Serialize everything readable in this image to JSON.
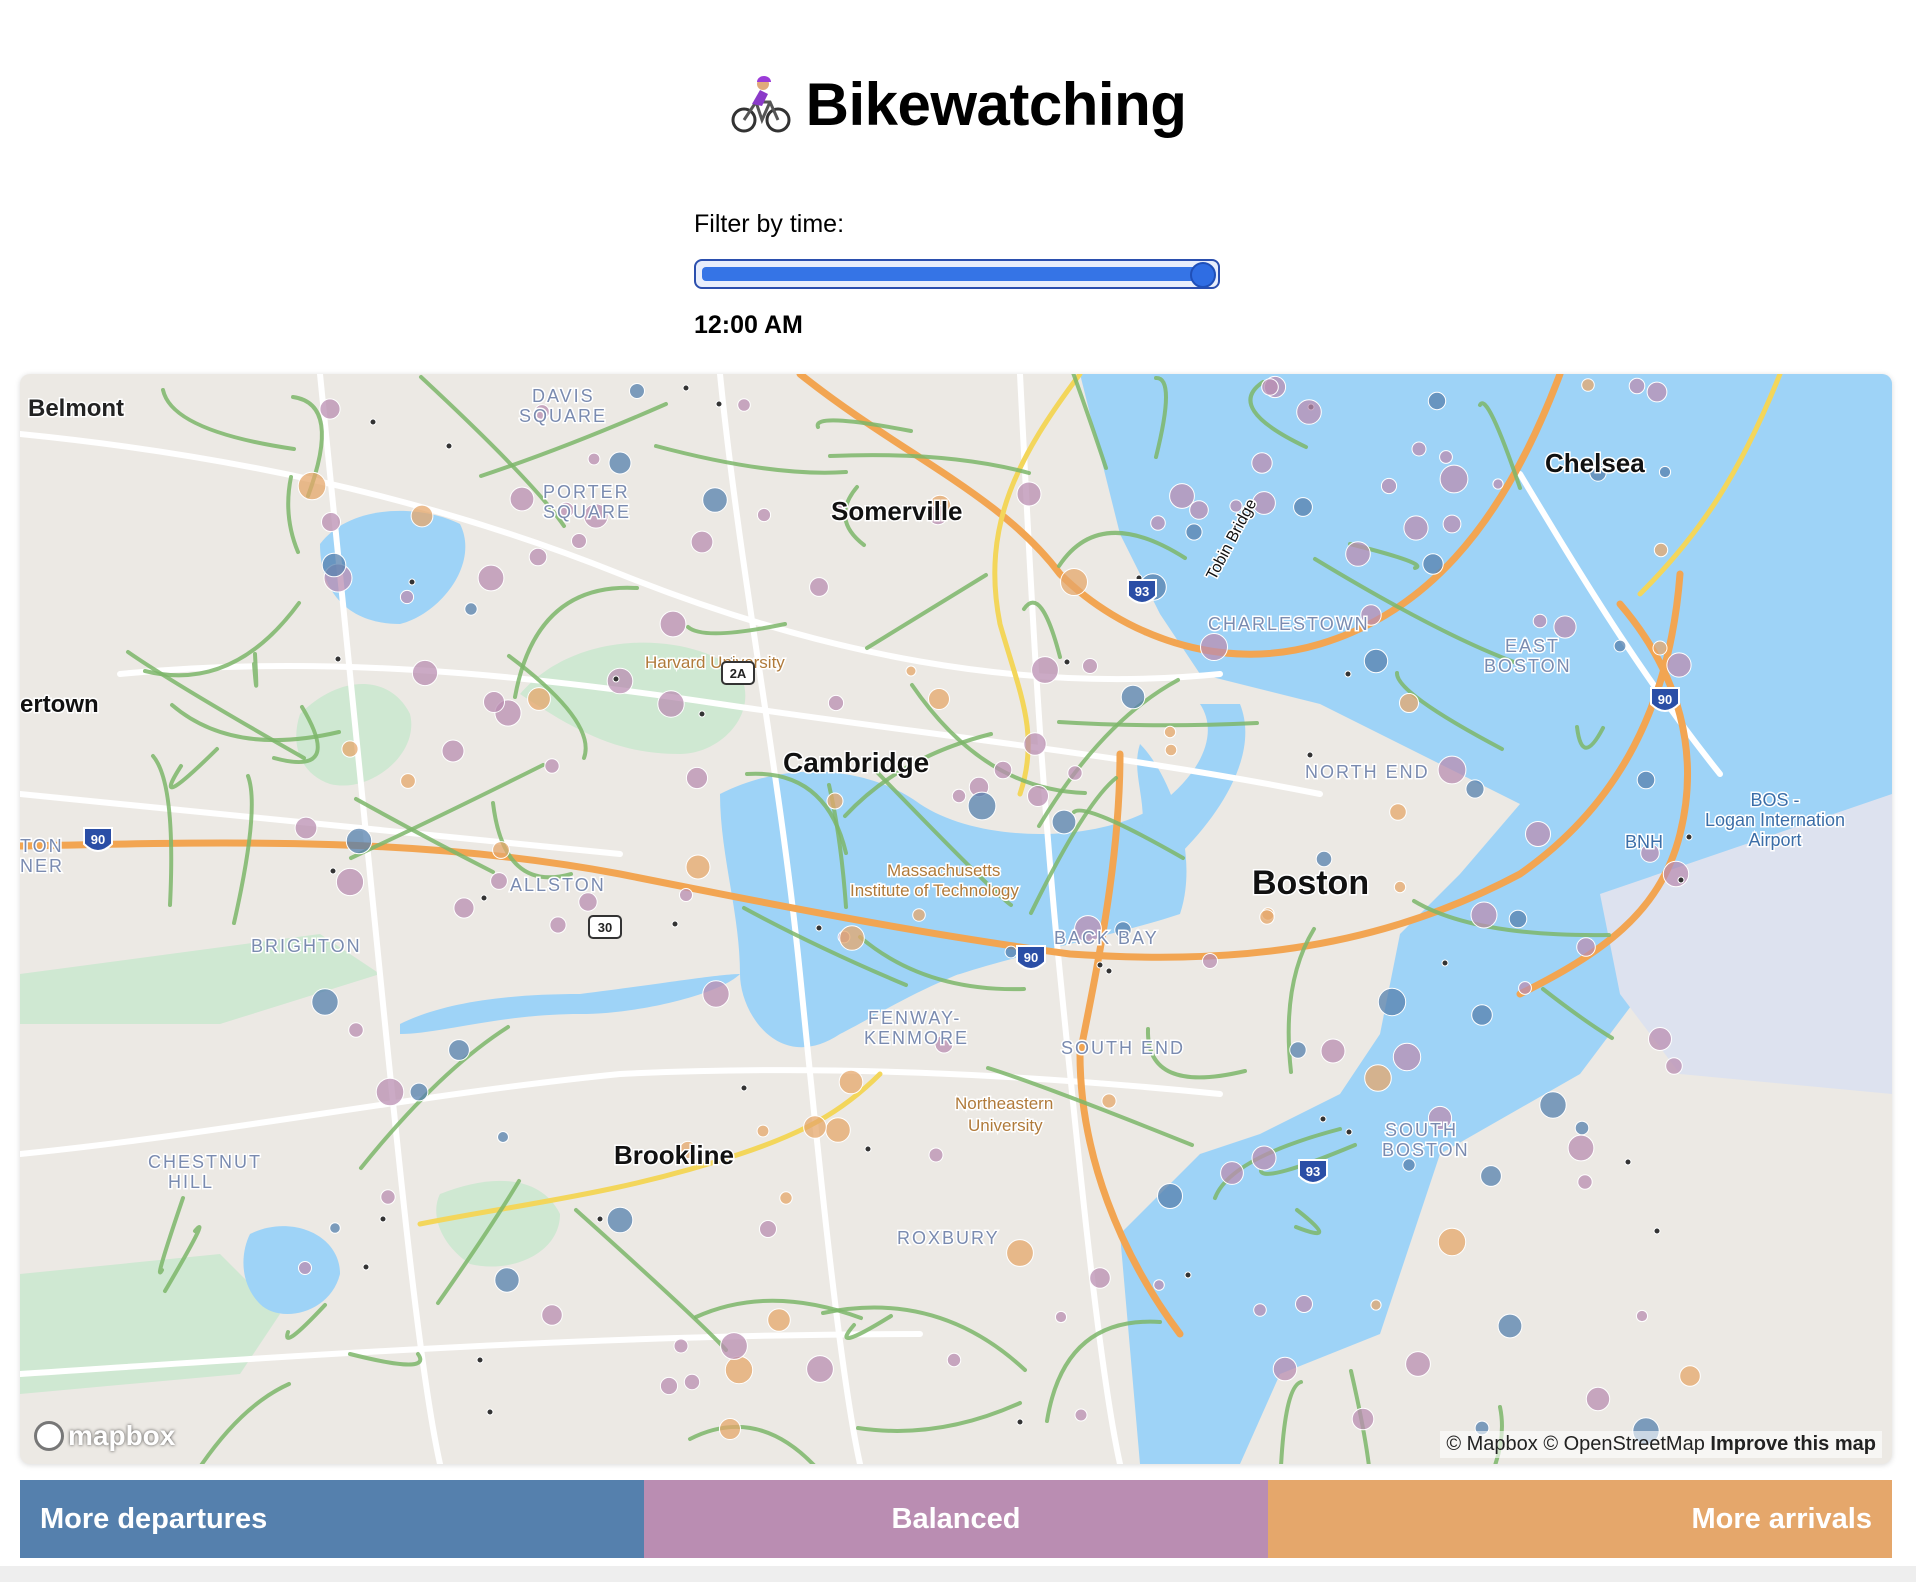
{
  "header": {
    "title": "Bikewatching",
    "icon": "person-biking-icon"
  },
  "filter": {
    "label": "Filter by time:",
    "value": 1.0,
    "time": "12:00 AM"
  },
  "map": {
    "labels": [
      {
        "text": "Belmont"
      },
      {
        "text": "DAVIS"
      },
      {
        "text": "SQUARE"
      },
      {
        "text": "PORTER"
      },
      {
        "text": "SQUARE"
      },
      {
        "text": "Somerville"
      },
      {
        "text": "Chelsea"
      },
      {
        "text": "CHARLESTOWN"
      },
      {
        "text": "EAST"
      },
      {
        "text": "BOSTON"
      },
      {
        "text": "Harvard University"
      },
      {
        "text": "Cambridge"
      },
      {
        "text": "NORTH END"
      },
      {
        "text": "ertown"
      },
      {
        "text": "Massachusetts"
      },
      {
        "text": "Institute of Technology"
      },
      {
        "text": "Boston"
      },
      {
        "text": "ALLSTON"
      },
      {
        "text": "BRIGHTON"
      },
      {
        "text": "BACK BAY"
      },
      {
        "text": "FENWAY-"
      },
      {
        "text": "KENMORE"
      },
      {
        "text": "SOUTH END"
      },
      {
        "text": "Northeastern"
      },
      {
        "text": "University"
      },
      {
        "text": "SOUTH"
      },
      {
        "text": "BOSTON"
      },
      {
        "text": "Brookline"
      },
      {
        "text": "CHESTNUT"
      },
      {
        "text": "HILL"
      },
      {
        "text": "ROXBURY"
      },
      {
        "text": "BOS -"
      },
      {
        "text": "Logan Internation"
      },
      {
        "text": "Airport"
      },
      {
        "text": "BNH"
      },
      {
        "text": "Tobin Bridge"
      },
      {
        "text": "TON"
      },
      {
        "text": "NER"
      }
    ],
    "shields": [
      "93",
      "90",
      "90",
      "90",
      "93",
      "2A",
      "30"
    ],
    "attribution": {
      "text": "© Mapbox © OpenStreetMap",
      "link": "Improve this map"
    },
    "logo": "mapbox"
  },
  "legend": {
    "departures": "More departures",
    "balanced": "Balanced",
    "arrivals": "More arrivals",
    "colors": {
      "departures": "#5580ad",
      "balanced": "#ba8db2",
      "arrivals": "#e5a76b"
    }
  }
}
